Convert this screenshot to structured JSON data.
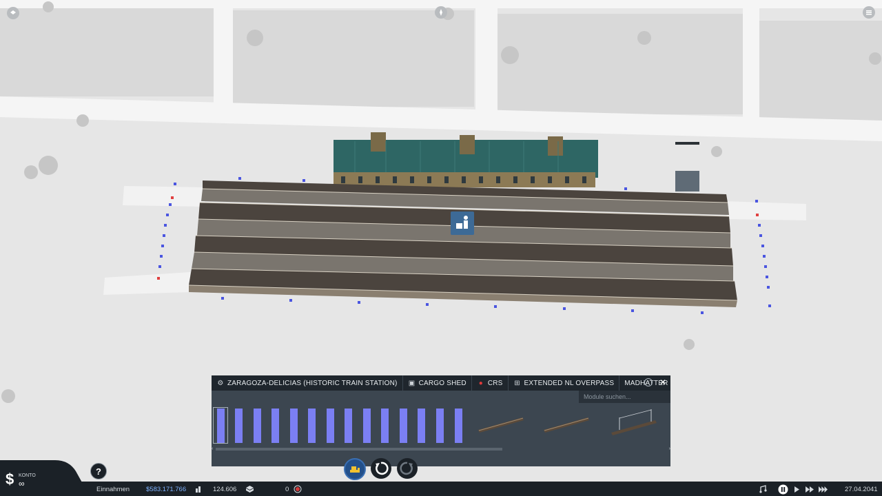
{
  "tabs": [
    {
      "label": "ZARAGOZA-DELICIAS (HISTORIC TRAIN STATION)",
      "icon": "gear-icon"
    },
    {
      "label": "CARGO SHED",
      "icon": "package-icon"
    },
    {
      "label": "CRS",
      "icon": "red-circle-icon"
    },
    {
      "label": "EXTENDED NL OVERPASS",
      "icon": "overpass-icon"
    },
    {
      "label": "MADHATTER BI",
      "icon": "none"
    }
  ],
  "search": {
    "placeholder": "Module suchen..."
  },
  "modules": {
    "platform_segments": 14,
    "items": [
      "track-segment-icon",
      "track-segment-icon",
      "catenary-segment-icon"
    ]
  },
  "toolbar": {
    "buttons": [
      "bulldozer-icon",
      "rotate-left-icon",
      "rotate-right-icon"
    ]
  },
  "status": {
    "konto_label": "KONTO",
    "konto_value": "∞",
    "income_label": "Einnahmen",
    "money": "$583.171.766",
    "population": "124.606",
    "cargo": "0",
    "date": "27.04.2041",
    "help": "?"
  },
  "colors": {
    "module_accent": "#7b7ff3",
    "panel_bg": "#3c4650",
    "tab_bg": "#1f262d",
    "money": "#7fb3ff",
    "station_marker": "#3d6a96",
    "roof": "#2e6664"
  }
}
